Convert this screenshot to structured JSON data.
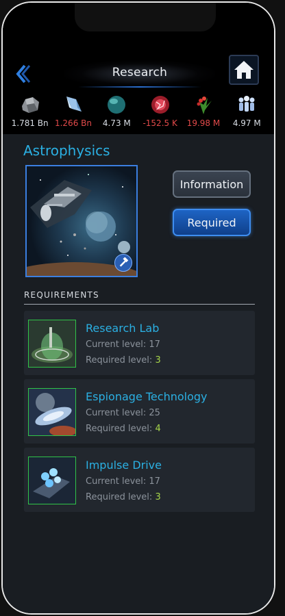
{
  "header": {
    "title": "Research"
  },
  "resources": [
    {
      "icon": "metal-icon",
      "value": "1.781 Bn",
      "negative": false
    },
    {
      "icon": "crystal-icon",
      "value": "1.266 Bn",
      "negative": true
    },
    {
      "icon": "deuterium-icon",
      "value": "4.73 M",
      "negative": false
    },
    {
      "icon": "energy-icon",
      "value": "-152.5 K",
      "negative": true
    },
    {
      "icon": "food-icon",
      "value": "19.98 M",
      "negative": true
    },
    {
      "icon": "population-icon",
      "value": "4.97 M",
      "negative": false
    }
  ],
  "tech": {
    "name": "Astrophysics"
  },
  "buttons": {
    "information": "Information",
    "required": "Required"
  },
  "requirements": {
    "heading": "Requirements",
    "items": [
      {
        "name": "Research Lab",
        "current_label": "Current level:",
        "current": "17",
        "required_label": "Required level:",
        "required": "3"
      },
      {
        "name": "Espionage Technology",
        "current_label": "Current level:",
        "current": "25",
        "required_label": "Required level:",
        "required": "4"
      },
      {
        "name": "Impulse Drive",
        "current_label": "Current level:",
        "current": "17",
        "required_label": "Required level:",
        "required": "3"
      }
    ]
  },
  "colors": {
    "accent": "#2bb0e3",
    "negative": "#e24a4a",
    "required_level": "#a6d64a",
    "button_blue": "#1e64c4"
  }
}
